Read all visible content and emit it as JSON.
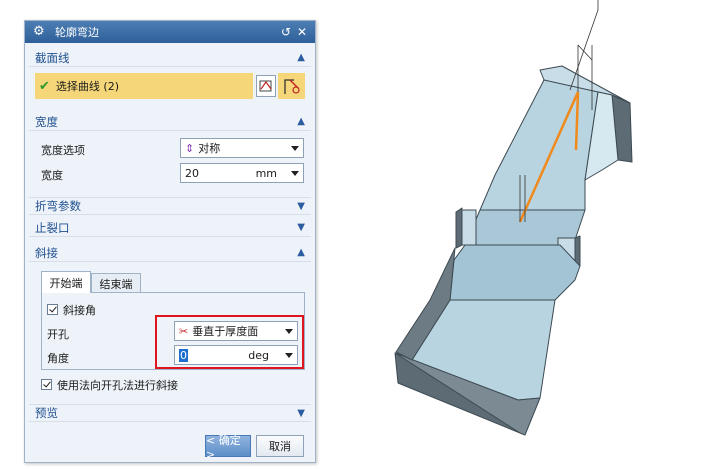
{
  "dialog": {
    "title": "轮廓弯边",
    "sections": {
      "section_curve": {
        "title": "截面线",
        "select_curve_label": "选择曲线 (2)"
      },
      "width": {
        "title": "宽度",
        "option_label": "宽度选项",
        "option_value": "对称",
        "width_label": "宽度",
        "width_value": "20",
        "width_unit": "mm"
      },
      "bend_params": {
        "title": "折弯参数"
      },
      "relief": {
        "title": "止裂口"
      },
      "miter": {
        "title": "斜接",
        "tabs": [
          "开始端",
          "结束端"
        ],
        "miter_angle_label": "斜接角",
        "hole_label": "开孔",
        "hole_value": "垂直于厚度面",
        "angle_label": "角度",
        "angle_value": "0",
        "angle_unit": "deg",
        "normal_hole_label": "使用法向开孔法进行斜接"
      },
      "preview": {
        "title": "预览"
      }
    },
    "ok_label": "< 确定 >",
    "cancel_label": "取消"
  },
  "colors": {
    "title_bar": "#3a6ea8",
    "section_title": "#1f4f8f",
    "selection_highlight": "#f5d77a",
    "red_highlight": "#e0141e",
    "model_face": "#b8d4e0",
    "model_edge": "#3d4a52",
    "orange_curve": "#f08a1c"
  }
}
